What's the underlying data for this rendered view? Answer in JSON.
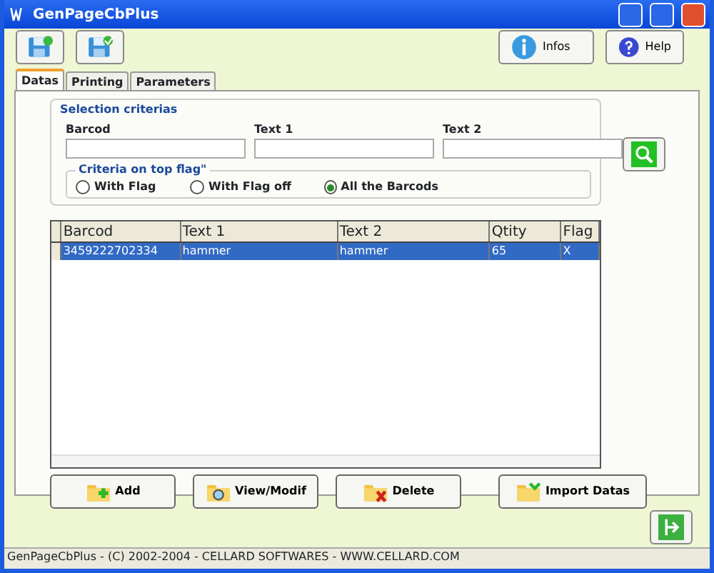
{
  "window": {
    "title": "GenPageCbPlus"
  },
  "toolbar": [
    {
      "label": "Infos",
      "kind": "info"
    },
    {
      "label": "Help",
      "kind": "help"
    }
  ],
  "tabs": [
    {
      "label": "Datas",
      "selected": true
    },
    {
      "label": "Printing",
      "selected": false
    },
    {
      "label": "Parameters",
      "selected": false
    }
  ],
  "selection": {
    "title": "Selection criterias",
    "fields": [
      {
        "label": "Barcod"
      },
      {
        "label": "Text 1"
      },
      {
        "label": "Text 2"
      }
    ],
    "flag_group": {
      "title": "Criteria on top flag\"",
      "options": [
        {
          "label": "With Flag",
          "selected": false
        },
        {
          "label": "With Flag off",
          "selected": false
        },
        {
          "label": "All the Barcods",
          "selected": true
        }
      ]
    }
  },
  "table": {
    "columns": [
      "Barcod",
      "Text 1",
      "Text 2",
      "Qtity",
      "Flag"
    ],
    "rows": [
      {
        "cells": [
          "3459222702334",
          "hammer",
          "hammer",
          "65",
          "X"
        ],
        "selected": true
      }
    ]
  },
  "buttons": [
    {
      "label": "Add",
      "kind": "add"
    },
    {
      "label": "View/Modif",
      "kind": "view"
    },
    {
      "label": "Delete",
      "kind": "delete"
    },
    {
      "label": "Import Datas",
      "kind": "import"
    }
  ],
  "status_bar": "GenPageCbPlus - (C) 2002-2004 - CELLARD SOFTWARES - WWW.CELLARD.COM"
}
